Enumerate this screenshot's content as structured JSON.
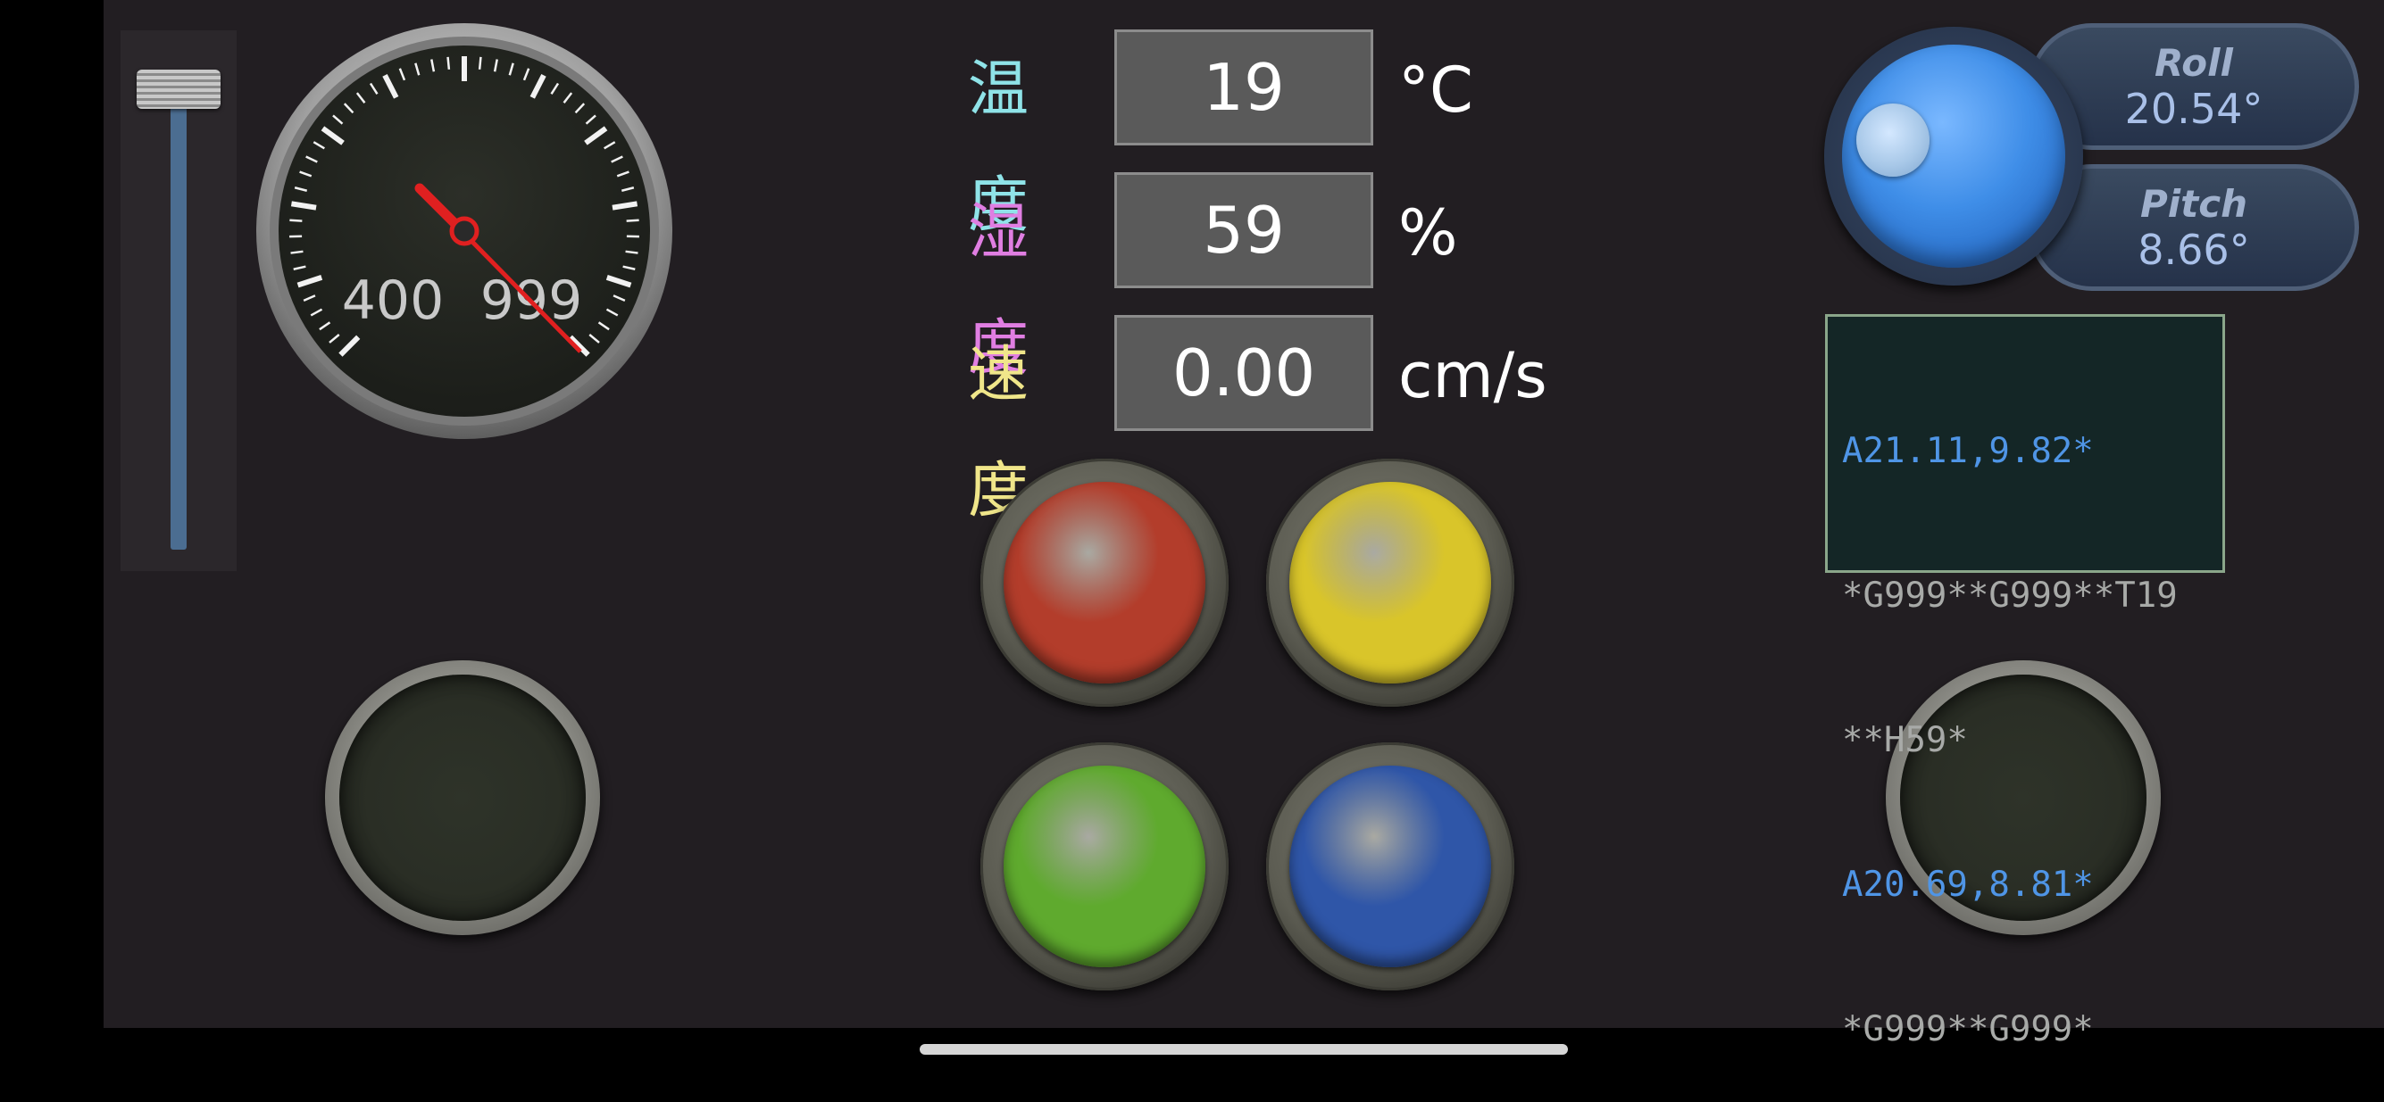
{
  "gauge": {
    "min_label": "400",
    "max_label": "999"
  },
  "readouts": [
    {
      "label": "温度",
      "value": "19",
      "unit": "°C",
      "label_color": "#8fe3e8"
    },
    {
      "label": "湿度",
      "value": "59",
      "unit": "%",
      "label_color": "#e07ee2"
    },
    {
      "label": "速度",
      "value": "0.00",
      "unit": "cm/s",
      "label_color": "#f0e68a"
    }
  ],
  "buttons": {
    "red_color": "#b33d2b",
    "yellow_color": "#d9c52a",
    "green_color": "#5faa2e",
    "blue_color": "#2f56a8"
  },
  "attitude": {
    "roll_label": "Roll",
    "roll_value": "20.54°",
    "pitch_label": "Pitch",
    "pitch_value": "8.66°"
  },
  "terminal": {
    "lines": [
      {
        "text": "A21.11,9.82*",
        "color": "blue"
      },
      {
        "text": "*G999**G999**T19",
        "color": "gray"
      },
      {
        "text": "**H59*",
        "color": "gray"
      },
      {
        "text": "A20.69,8.81*",
        "color": "blue"
      },
      {
        "text": "*G999**G999*",
        "color": "gray"
      }
    ]
  }
}
